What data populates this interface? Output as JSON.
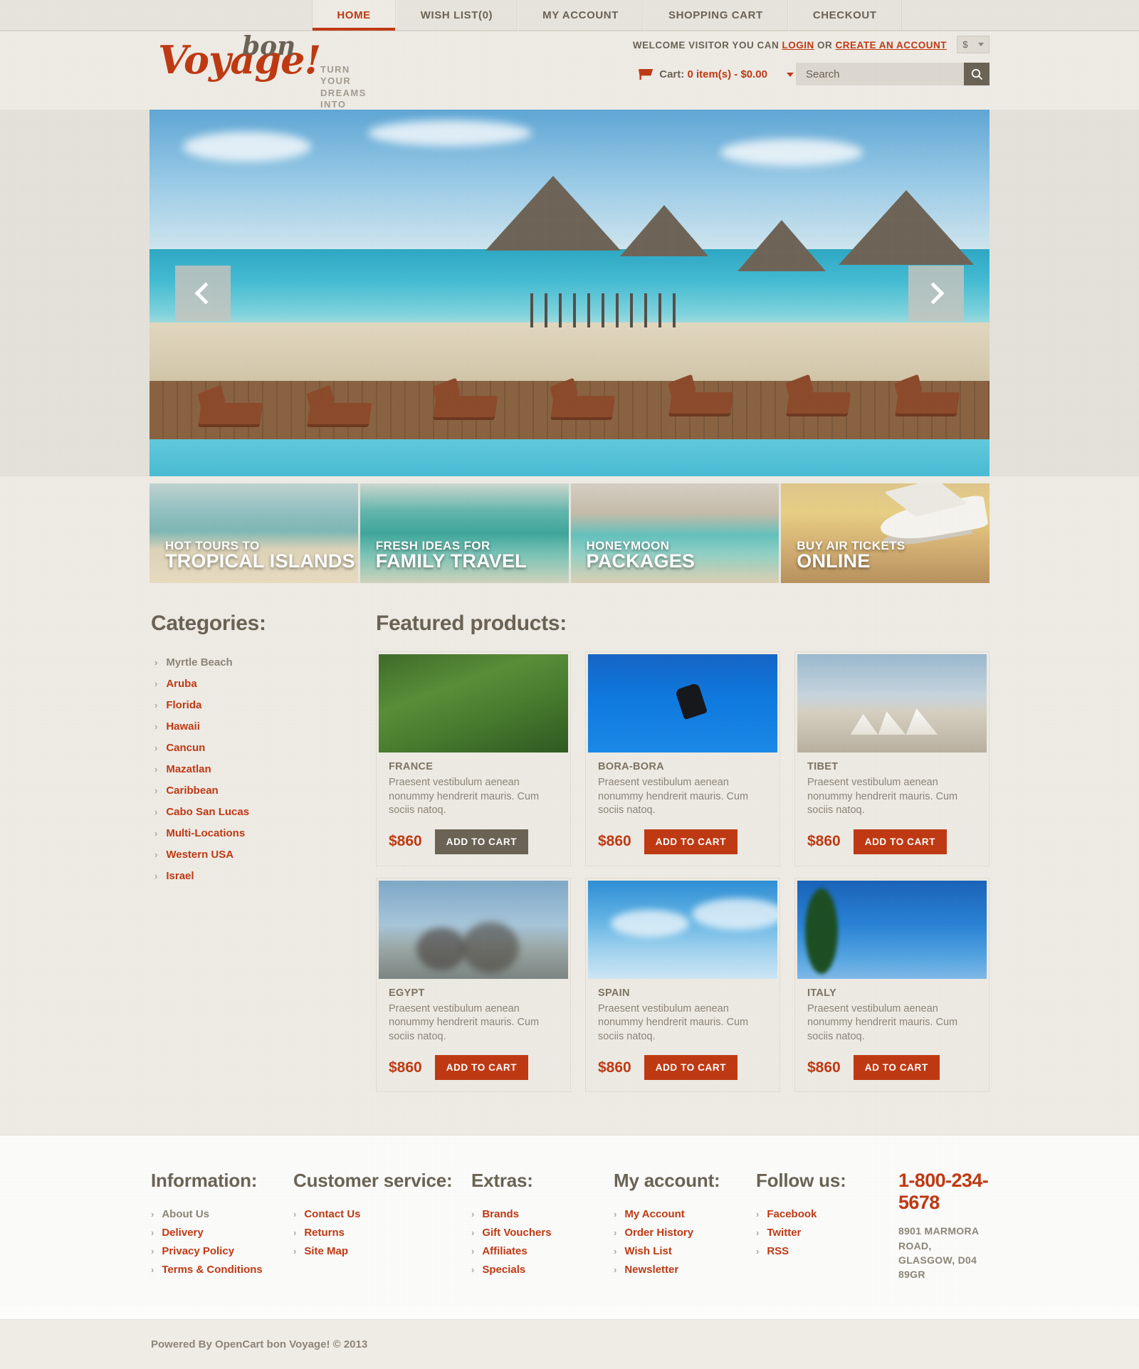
{
  "nav": {
    "items": [
      {
        "label": "HOME",
        "active": true
      },
      {
        "label": "WISH LIST(0)",
        "active": false
      },
      {
        "label": "MY ACCOUNT",
        "active": false
      },
      {
        "label": "SHOPPING CART",
        "active": false
      },
      {
        "label": "CHECKOUT",
        "active": false
      }
    ]
  },
  "header": {
    "logo_main": "Voyage",
    "logo_bang": "!",
    "logo_bon": "bon",
    "tagline": "TURN YOUR DREAMS\nINTO REALITY",
    "welcome_prefix": "WELCOME VISITOR YOU CAN",
    "login_label": "LOGIN",
    "welcome_or": "OR",
    "create_account_label": "CREATE AN ACCOUNT",
    "currency_symbol": "$",
    "cart_label": "Cart:",
    "cart_value": "0 item(s) - $0.00",
    "search_placeholder": "Search",
    "search_value": "",
    "search_icon": "search-icon"
  },
  "slider": {
    "prev_icon": "chevron-left-icon",
    "next_icon": "chevron-right-icon",
    "alt": "Overwater bungalows resort with beach loungers"
  },
  "promos": [
    {
      "line1": "HOT TOURS TO",
      "line2": "TROPICAL ISLANDS"
    },
    {
      "line1": "FRESH IDEAS FOR",
      "line2": "FAMILY TRAVEL"
    },
    {
      "line1": "HONEYMOON",
      "line2": "PACKAGES"
    },
    {
      "line1": "BUY AIR TICKETS",
      "line2": "ONLINE"
    }
  ],
  "sidebar": {
    "title": "Categories:",
    "items": [
      {
        "label": "Myrtle Beach",
        "muted": true
      },
      {
        "label": "Aruba",
        "muted": false
      },
      {
        "label": "Florida",
        "muted": false
      },
      {
        "label": "Hawaii",
        "muted": false
      },
      {
        "label": "Cancun",
        "muted": false
      },
      {
        "label": "Mazatlan",
        "muted": false
      },
      {
        "label": "Caribbean",
        "muted": false
      },
      {
        "label": "Cabo San Lucas",
        "muted": false
      },
      {
        "label": "Multi-Locations",
        "muted": false
      },
      {
        "label": "Western USA",
        "muted": false
      },
      {
        "label": "Israel",
        "muted": false
      }
    ]
  },
  "featured": {
    "title": "Featured products:",
    "products": [
      {
        "name": "FRANCE",
        "desc": "Praesent vestibulum aenean nonummy hendrerit mauris. Cum sociis natoq.",
        "price": "$860",
        "button": "ADD TO CART",
        "button_hovered": true,
        "img": "img-france"
      },
      {
        "name": "BORA-BORA",
        "desc": "Praesent vestibulum aenean nonummy hendrerit mauris. Cum sociis natoq.",
        "price": "$860",
        "button": "ADD TO CART",
        "button_hovered": false,
        "img": "img-borabora"
      },
      {
        "name": "TIBET",
        "desc": "Praesent vestibulum aenean nonummy hendrerit mauris. Cum sociis natoq.",
        "price": "$860",
        "button": "ADD TO CART",
        "button_hovered": false,
        "img": "img-tibet"
      },
      {
        "name": "EGYPT",
        "desc": "Praesent vestibulum aenean nonummy hendrerit mauris. Cum sociis natoq.",
        "price": "$860",
        "button": "ADD TO CART",
        "button_hovered": false,
        "img": "img-egypt"
      },
      {
        "name": "SPAIN",
        "desc": "Praesent vestibulum aenean nonummy hendrerit mauris. Cum sociis natoq.",
        "price": "$860",
        "button": "ADD TO CART",
        "button_hovered": false,
        "img": "img-spain"
      },
      {
        "name": "ITALY",
        "desc": "Praesent vestibulum aenean nonummy hendrerit mauris. Cum sociis natoq.",
        "price": "$860",
        "button": "AD TO CART",
        "button_hovered": false,
        "img": "img-italy"
      }
    ]
  },
  "footer": {
    "columns": [
      {
        "title": "Information:",
        "links": [
          {
            "label": "About Us",
            "muted": true
          },
          {
            "label": "Delivery",
            "muted": false
          },
          {
            "label": "Privacy Policy",
            "muted": false
          },
          {
            "label": "Terms & Conditions",
            "muted": false
          }
        ]
      },
      {
        "title": "Customer service:",
        "links": [
          {
            "label": "Contact Us",
            "muted": false
          },
          {
            "label": "Returns",
            "muted": false
          },
          {
            "label": "Site Map",
            "muted": false
          }
        ]
      },
      {
        "title": "Extras:",
        "links": [
          {
            "label": "Brands",
            "muted": false
          },
          {
            "label": "Gift Vouchers",
            "muted": false
          },
          {
            "label": "Affiliates",
            "muted": false
          },
          {
            "label": "Specials",
            "muted": false
          }
        ]
      },
      {
        "title": "My account:",
        "links": [
          {
            "label": "My Account",
            "muted": false
          },
          {
            "label": "Order History",
            "muted": false
          },
          {
            "label": "Wish List",
            "muted": false
          },
          {
            "label": "Newsletter",
            "muted": false
          }
        ]
      },
      {
        "title": "Follow us:",
        "links": [
          {
            "label": "Facebook",
            "muted": false
          },
          {
            "label": "Twitter",
            "muted": false
          },
          {
            "label": "RSS",
            "muted": false
          }
        ]
      }
    ],
    "phone": "1-800-234-5678",
    "address": "8901 MARMORA ROAD, GLASGOW, D04 89GR",
    "copyright": "Powered By OpenCart bon Voyage! © 2013"
  },
  "colors": {
    "accent": "#bf3a13",
    "text": "#6b6355",
    "muted": "#8d8578",
    "page_bg": "#efece6"
  }
}
